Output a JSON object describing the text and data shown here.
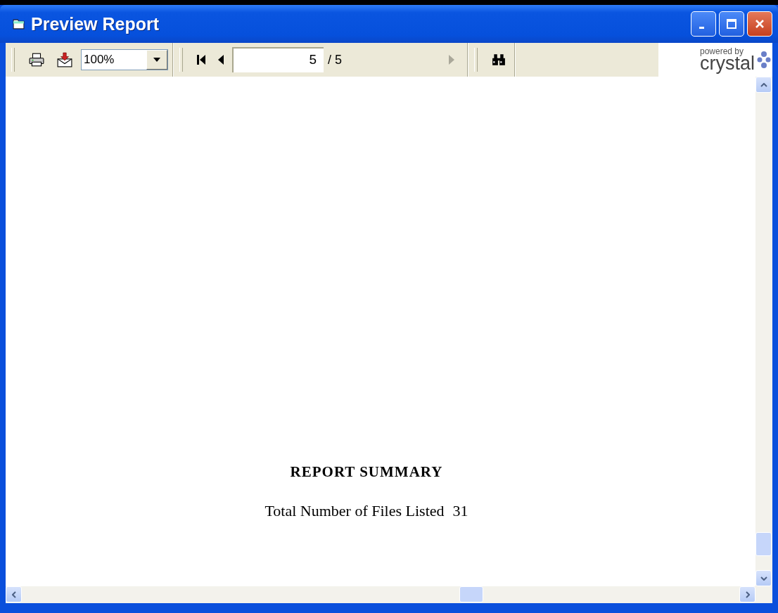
{
  "window": {
    "title": "Preview Report"
  },
  "toolbar": {
    "zoom": "100%",
    "page_field": "5",
    "page_total": "/ 5",
    "next_page": {
      "disabled": true
    },
    "logo": {
      "tagline": "powered by",
      "name": "crystal"
    }
  },
  "report": {
    "heading": "REPORT SUMMARY",
    "total_label": "Total Number of Files Listed",
    "total_value": "31"
  }
}
